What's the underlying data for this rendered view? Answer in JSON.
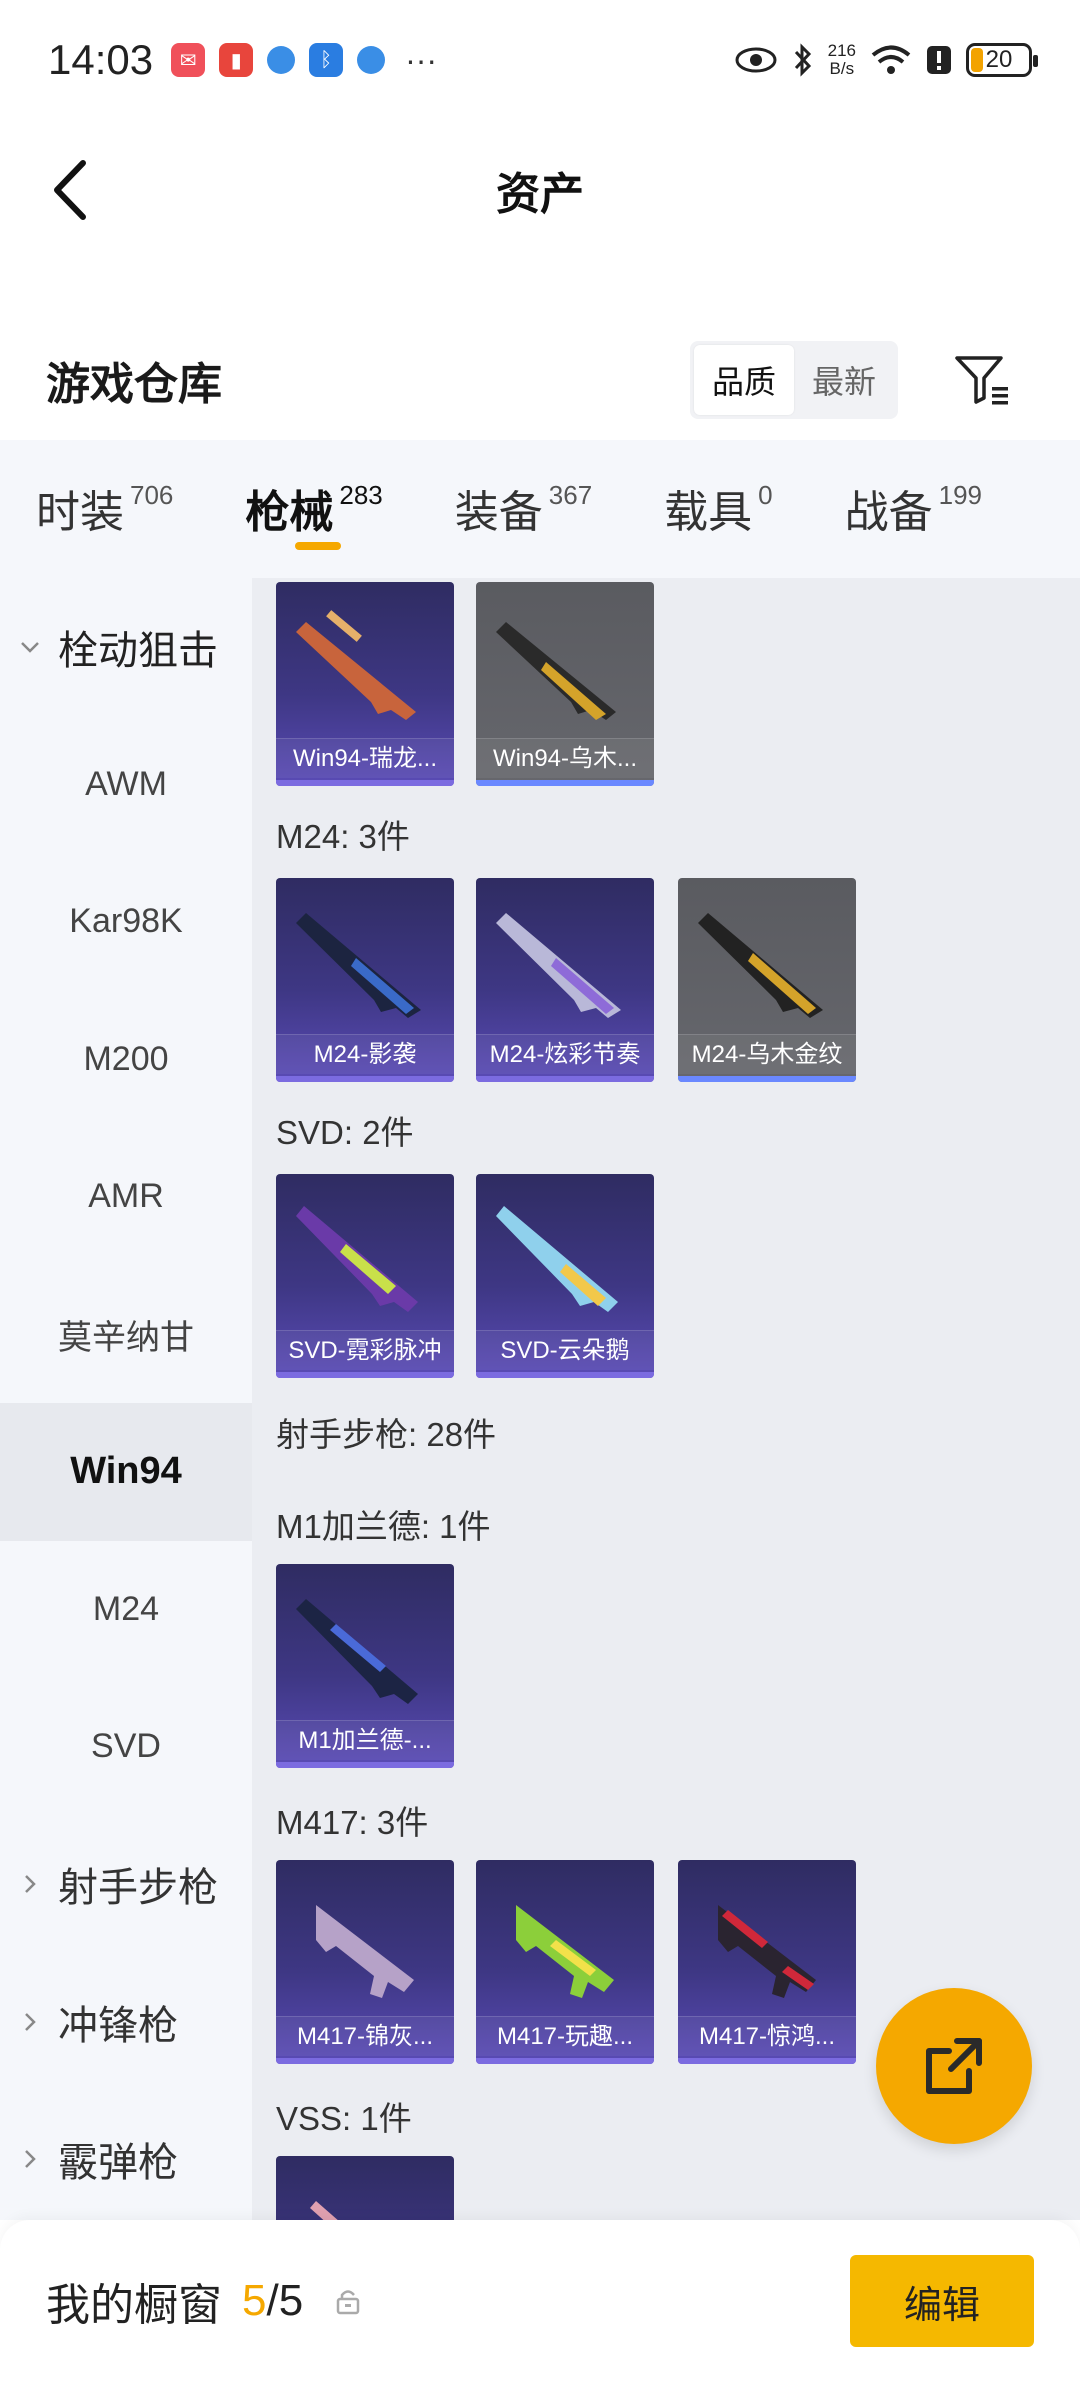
{
  "status_bar": {
    "time": "14:03",
    "net_speed_value": "216",
    "net_speed_unit": "B/s",
    "battery": "20",
    "more": "···"
  },
  "header": {
    "title": "资产"
  },
  "warehouse": {
    "title": "游戏仓库",
    "sort": {
      "quality": "品质",
      "latest": "最新",
      "selected": "品质"
    }
  },
  "categories": [
    {
      "label": "时装",
      "count": "706"
    },
    {
      "label": "枪械",
      "count": "283"
    },
    {
      "label": "装备",
      "count": "367"
    },
    {
      "label": "载具",
      "count": "0"
    },
    {
      "label": "战备",
      "count": "199"
    }
  ],
  "sidebar": {
    "items": [
      {
        "label": "栓动狙击"
      },
      {
        "label": "AWM"
      },
      {
        "label": "Kar98K"
      },
      {
        "label": "M200"
      },
      {
        "label": "AMR"
      },
      {
        "label": "莫辛纳甘"
      },
      {
        "label": "Win94"
      },
      {
        "label": "M24"
      },
      {
        "label": "SVD"
      },
      {
        "label": "射手步枪"
      },
      {
        "label": "冲锋枪"
      },
      {
        "label": "霰弹枪"
      }
    ]
  },
  "groups": {
    "win94": {
      "items": [
        "Win94-瑞龙...",
        "Win94-乌木..."
      ]
    },
    "m24": {
      "label": "M24: 3件",
      "items": [
        "M24-影袭",
        "M24-炫彩节奏",
        "M24-乌木金纹"
      ]
    },
    "svd": {
      "label": "SVD: 2件",
      "items": [
        "SVD-霓彩脉冲",
        "SVD-云朵鹅"
      ]
    },
    "marksman": {
      "label": "射手步枪: 28件"
    },
    "m1garand": {
      "label": "M1加兰德: 1件",
      "items": [
        "M1加兰德-..."
      ]
    },
    "m417": {
      "label": "M417: 3件",
      "items": [
        "M417-锦灰...",
        "M417-玩趣...",
        "M417-惊鸿..."
      ]
    },
    "vss": {
      "label": "VSS: 1件"
    }
  },
  "bottom": {
    "label": "我的橱窗",
    "current": "5",
    "separator": "/",
    "max": "5",
    "edit": "编辑"
  }
}
